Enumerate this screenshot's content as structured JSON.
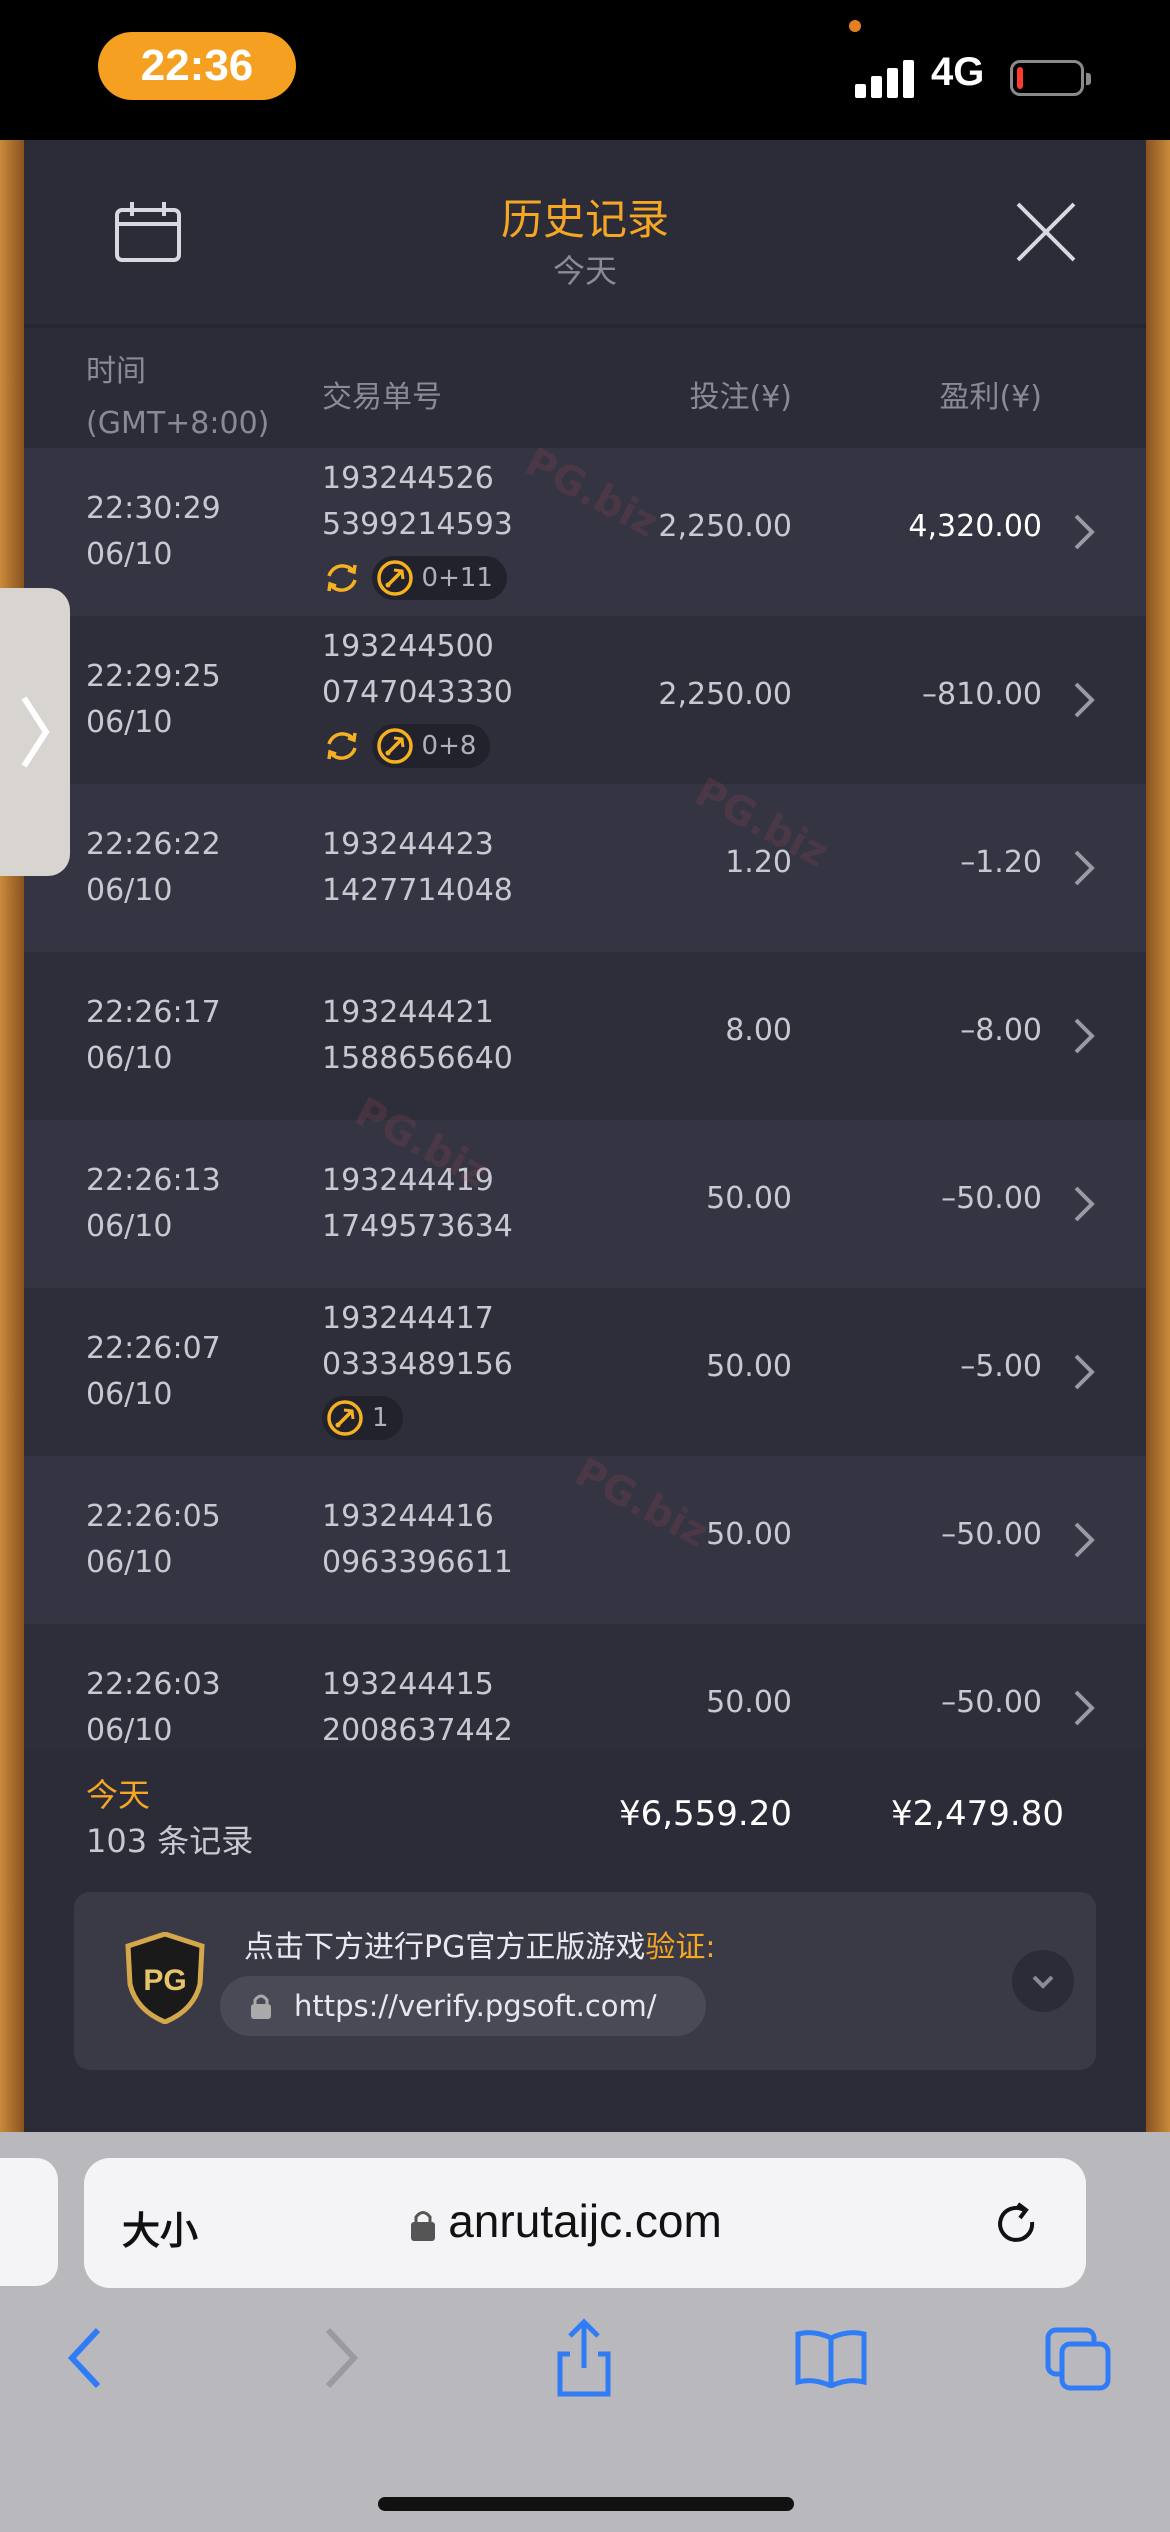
{
  "status_bar": {
    "time": "22:36",
    "network": "4G",
    "battery_level": 0.1
  },
  "modal": {
    "title": "历史记录",
    "subtitle": "今天",
    "headers": {
      "time_line1": "时间",
      "time_line2": "(GMT+8:00)",
      "order": "交易单号",
      "bet": "投注(¥)",
      "profit": "盈利(¥)"
    },
    "rows": [
      {
        "time": "22:30:29",
        "date": "06/10",
        "order1": "193244526",
        "order2": "5399214593",
        "bet": "2,250.00",
        "profit": "4,320.00",
        "badge": "0+11",
        "respin": true
      },
      {
        "time": "22:29:25",
        "date": "06/10",
        "order1": "193244500",
        "order2": "0747043330",
        "bet": "2,250.00",
        "profit": "–810.00",
        "badge": "0+8",
        "respin": true
      },
      {
        "time": "22:26:22",
        "date": "06/10",
        "order1": "193244423",
        "order2": "1427714048",
        "bet": "1.20",
        "profit": "–1.20",
        "badge": "",
        "respin": false
      },
      {
        "time": "22:26:17",
        "date": "06/10",
        "order1": "193244421",
        "order2": "1588656640",
        "bet": "8.00",
        "profit": "–8.00",
        "badge": "",
        "respin": false
      },
      {
        "time": "22:26:13",
        "date": "06/10",
        "order1": "193244419",
        "order2": "1749573634",
        "bet": "50.00",
        "profit": "–50.00",
        "badge": "",
        "respin": false
      },
      {
        "time": "22:26:07",
        "date": "06/10",
        "order1": "193244417",
        "order2": "0333489156",
        "bet": "50.00",
        "profit": "–5.00",
        "badge": "1",
        "respin": false
      },
      {
        "time": "22:26:05",
        "date": "06/10",
        "order1": "193244416",
        "order2": "0963396611",
        "bet": "50.00",
        "profit": "–50.00",
        "badge": "",
        "respin": false
      },
      {
        "time": "22:26:03",
        "date": "06/10",
        "order1": "193244415",
        "order2": "2008637442",
        "bet": "50.00",
        "profit": "–50.00",
        "badge": "",
        "respin": false
      }
    ],
    "summary": {
      "label": "今天",
      "count": "103 条记录",
      "total_bet": "¥6,559.20",
      "total_profit": "¥2,479.80"
    },
    "verify": {
      "text": "点击下方进行PG官方正版游戏",
      "highlight": "验证:",
      "url": "https://verify.pgsoft.com/",
      "logo_text": "PG"
    }
  },
  "browser": {
    "text_size_label": "大小",
    "url": "anrutaijc.com"
  },
  "watermark": "PG.biz",
  "colors": {
    "accent": "#f5a623",
    "modal_bg": "#2c2c38",
    "safari_blue": "#2f7cf6"
  }
}
